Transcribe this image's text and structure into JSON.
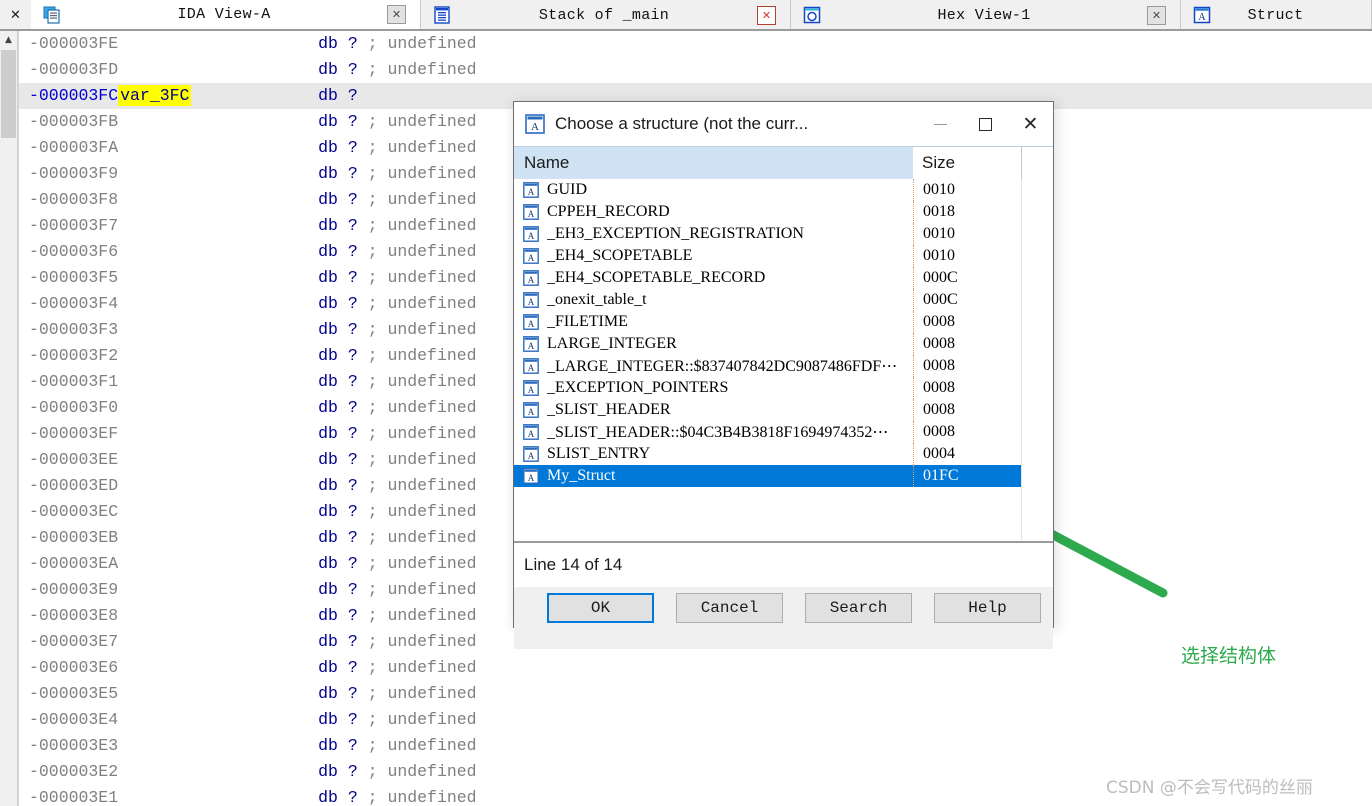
{
  "window": {
    "close_label": "✕"
  },
  "tabs": [
    {
      "label": "IDA View-A",
      "icon": "document-icon",
      "active": true,
      "close": "✕",
      "close_style": "grey"
    },
    {
      "label": "Stack of _main",
      "icon": "stack-icon",
      "active": false,
      "close": "✕",
      "close_style": "red"
    },
    {
      "label": "Hex View-1",
      "icon": "hex-icon",
      "active": false,
      "close": "✕",
      "close_style": "grey"
    },
    {
      "label": "Struct",
      "icon": "struct-icon",
      "active": false,
      "close": "",
      "close_style": "none"
    }
  ],
  "listing": {
    "mnemonic": "db",
    "operand": "?",
    "comment": "; undefined",
    "highlight_var": "var_3FC",
    "rows": [
      {
        "addr": "-000003FE",
        "name": "",
        "comment": "; undefined",
        "highlight": false
      },
      {
        "addr": "-000003FD",
        "name": "",
        "comment": "; undefined",
        "highlight": false
      },
      {
        "addr": "-000003FC",
        "name": "var_3FC",
        "comment": "",
        "highlight": true
      },
      {
        "addr": "-000003FB",
        "name": "",
        "comment": "; undefined",
        "highlight": false
      },
      {
        "addr": "-000003FA",
        "name": "",
        "comment": "; undefined",
        "highlight": false
      },
      {
        "addr": "-000003F9",
        "name": "",
        "comment": "; undefined",
        "highlight": false
      },
      {
        "addr": "-000003F8",
        "name": "",
        "comment": "; undefined",
        "highlight": false
      },
      {
        "addr": "-000003F7",
        "name": "",
        "comment": "; undefined",
        "highlight": false
      },
      {
        "addr": "-000003F6",
        "name": "",
        "comment": "; undefined",
        "highlight": false
      },
      {
        "addr": "-000003F5",
        "name": "",
        "comment": "; undefined",
        "highlight": false
      },
      {
        "addr": "-000003F4",
        "name": "",
        "comment": "; undefined",
        "highlight": false
      },
      {
        "addr": "-000003F3",
        "name": "",
        "comment": "; undefined",
        "highlight": false
      },
      {
        "addr": "-000003F2",
        "name": "",
        "comment": "; undefined",
        "highlight": false
      },
      {
        "addr": "-000003F1",
        "name": "",
        "comment": "; undefined",
        "highlight": false
      },
      {
        "addr": "-000003F0",
        "name": "",
        "comment": "; undefined",
        "highlight": false
      },
      {
        "addr": "-000003EF",
        "name": "",
        "comment": "; undefined",
        "highlight": false
      },
      {
        "addr": "-000003EE",
        "name": "",
        "comment": "; undefined",
        "highlight": false
      },
      {
        "addr": "-000003ED",
        "name": "",
        "comment": "; undefined",
        "highlight": false
      },
      {
        "addr": "-000003EC",
        "name": "",
        "comment": "; undefined",
        "highlight": false
      },
      {
        "addr": "-000003EB",
        "name": "",
        "comment": "; undefined",
        "highlight": false
      },
      {
        "addr": "-000003EA",
        "name": "",
        "comment": "; undefined",
        "highlight": false
      },
      {
        "addr": "-000003E9",
        "name": "",
        "comment": "; undefined",
        "highlight": false
      },
      {
        "addr": "-000003E8",
        "name": "",
        "comment": "; undefined",
        "highlight": false
      },
      {
        "addr": "-000003E7",
        "name": "",
        "comment": "; undefined",
        "highlight": false
      },
      {
        "addr": "-000003E6",
        "name": "",
        "comment": "; undefined",
        "highlight": false
      },
      {
        "addr": "-000003E5",
        "name": "",
        "comment": "; undefined",
        "highlight": false
      },
      {
        "addr": "-000003E4",
        "name": "",
        "comment": "; undefined",
        "highlight": false
      },
      {
        "addr": "-000003E3",
        "name": "",
        "comment": "; undefined",
        "highlight": false
      },
      {
        "addr": "-000003E2",
        "name": "",
        "comment": "; undefined",
        "highlight": false
      },
      {
        "addr": "-000003E1",
        "name": "",
        "comment": "; undefined",
        "highlight": false
      }
    ]
  },
  "dialog": {
    "title": "Choose a structure (not the curr...",
    "title_icon": "struct-icon",
    "minimize_label": "–",
    "maximize_label": "☐",
    "close_label": "✕",
    "columns": {
      "name": "Name",
      "size": "Size"
    },
    "status": "Line 14 of 14",
    "buttons": [
      {
        "label": "OK",
        "default": true
      },
      {
        "label": "Cancel",
        "default": false
      },
      {
        "label": "Search",
        "default": false
      },
      {
        "label": "Help",
        "default": false
      }
    ],
    "rows": [
      {
        "name": "GUID",
        "size": "0010",
        "selected": false
      },
      {
        "name": "CPPEH_RECORD",
        "size": "0018",
        "selected": false
      },
      {
        "name": "_EH3_EXCEPTION_REGISTRATION",
        "size": "0010",
        "selected": false
      },
      {
        "name": "_EH4_SCOPETABLE",
        "size": "0010",
        "selected": false
      },
      {
        "name": "_EH4_SCOPETABLE_RECORD",
        "size": "000C",
        "selected": false
      },
      {
        "name": "_onexit_table_t",
        "size": "000C",
        "selected": false
      },
      {
        "name": "_FILETIME",
        "size": "0008",
        "selected": false
      },
      {
        "name": "LARGE_INTEGER",
        "size": "0008",
        "selected": false
      },
      {
        "name": "_LARGE_INTEGER::$837407842DC9087486FDF⋯",
        "size": "0008",
        "selected": false
      },
      {
        "name": "_EXCEPTION_POINTERS",
        "size": "0008",
        "selected": false
      },
      {
        "name": "_SLIST_HEADER",
        "size": "0008",
        "selected": false
      },
      {
        "name": "_SLIST_HEADER::$04C3B4B3818F1694974352⋯",
        "size": "0008",
        "selected": false
      },
      {
        "name": "SLIST_ENTRY",
        "size": "0004",
        "selected": false
      },
      {
        "name": "My_Struct",
        "size": "01FC",
        "selected": true
      }
    ]
  },
  "annotation": {
    "label": "选择结构体",
    "color": "#2eaa4e",
    "arrow": "green-arrow"
  },
  "watermark": {
    "text": "CSDN @不会写代码的丝丽"
  },
  "colors": {
    "selection": "#0078d7",
    "highlight": "#ffff00",
    "accent_green": "#2eaa4e",
    "header": "#cfe3f5"
  }
}
